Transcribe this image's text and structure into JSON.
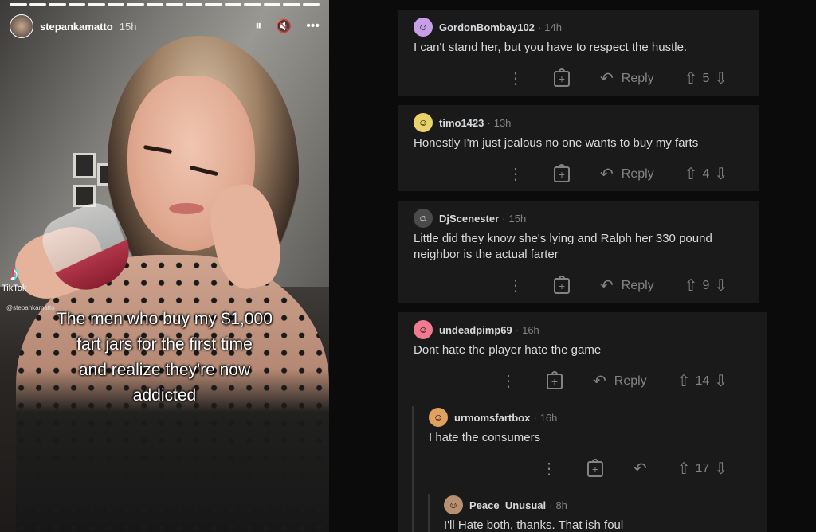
{
  "story": {
    "username": "stepankamatto",
    "time": "15h",
    "controls": {
      "pause": "⏸",
      "mute": "🔇",
      "more": "•••"
    },
    "tiktok_label": "TikTok",
    "tiktok_handle": "@stepankamatto",
    "caption_lines": [
      "The men who buy my $1,000",
      "fart jars for the first time",
      "and realize they're now",
      "addicted"
    ]
  },
  "comments": [
    {
      "user": "GordonBombay102",
      "time": "14h",
      "body": "I can't stand her, but you have to respect the hustle.",
      "reply_label": "Reply",
      "votes": "5",
      "avatar_color": "#c79fe8"
    },
    {
      "user": "timo1423",
      "time": "13h",
      "body": "Honestly I'm just jealous no one wants to buy my farts",
      "reply_label": "Reply",
      "votes": "4",
      "avatar_color": "#e8d26a"
    },
    {
      "user": "DjScenester",
      "time": "15h",
      "body": "Little did they know she's lying and Ralph her 330 pound neighbor is the actual farter",
      "reply_label": "Reply",
      "votes": "9",
      "avatar_color": "#4a4a4a"
    },
    {
      "user": "undeadpimp69",
      "time": "16h",
      "body": "Dont hate the player hate the game",
      "reply_label": "Reply",
      "votes": "14",
      "avatar_color": "#f07a90"
    },
    {
      "user": "urmomsfartbox",
      "time": "16h",
      "body": "I hate the consumers",
      "reply_label": "",
      "votes": "17",
      "avatar_color": "#e0a060"
    },
    {
      "user": "Peace_Unusual",
      "time": "8h",
      "body": "I'll Hate both, thanks. That ish foul",
      "avatar_color": "#b89070"
    }
  ],
  "separator": "·",
  "icons": {
    "more": "⋮",
    "award": "+",
    "reply": "↶",
    "upvote": "⇧",
    "downvote": "⇩"
  }
}
